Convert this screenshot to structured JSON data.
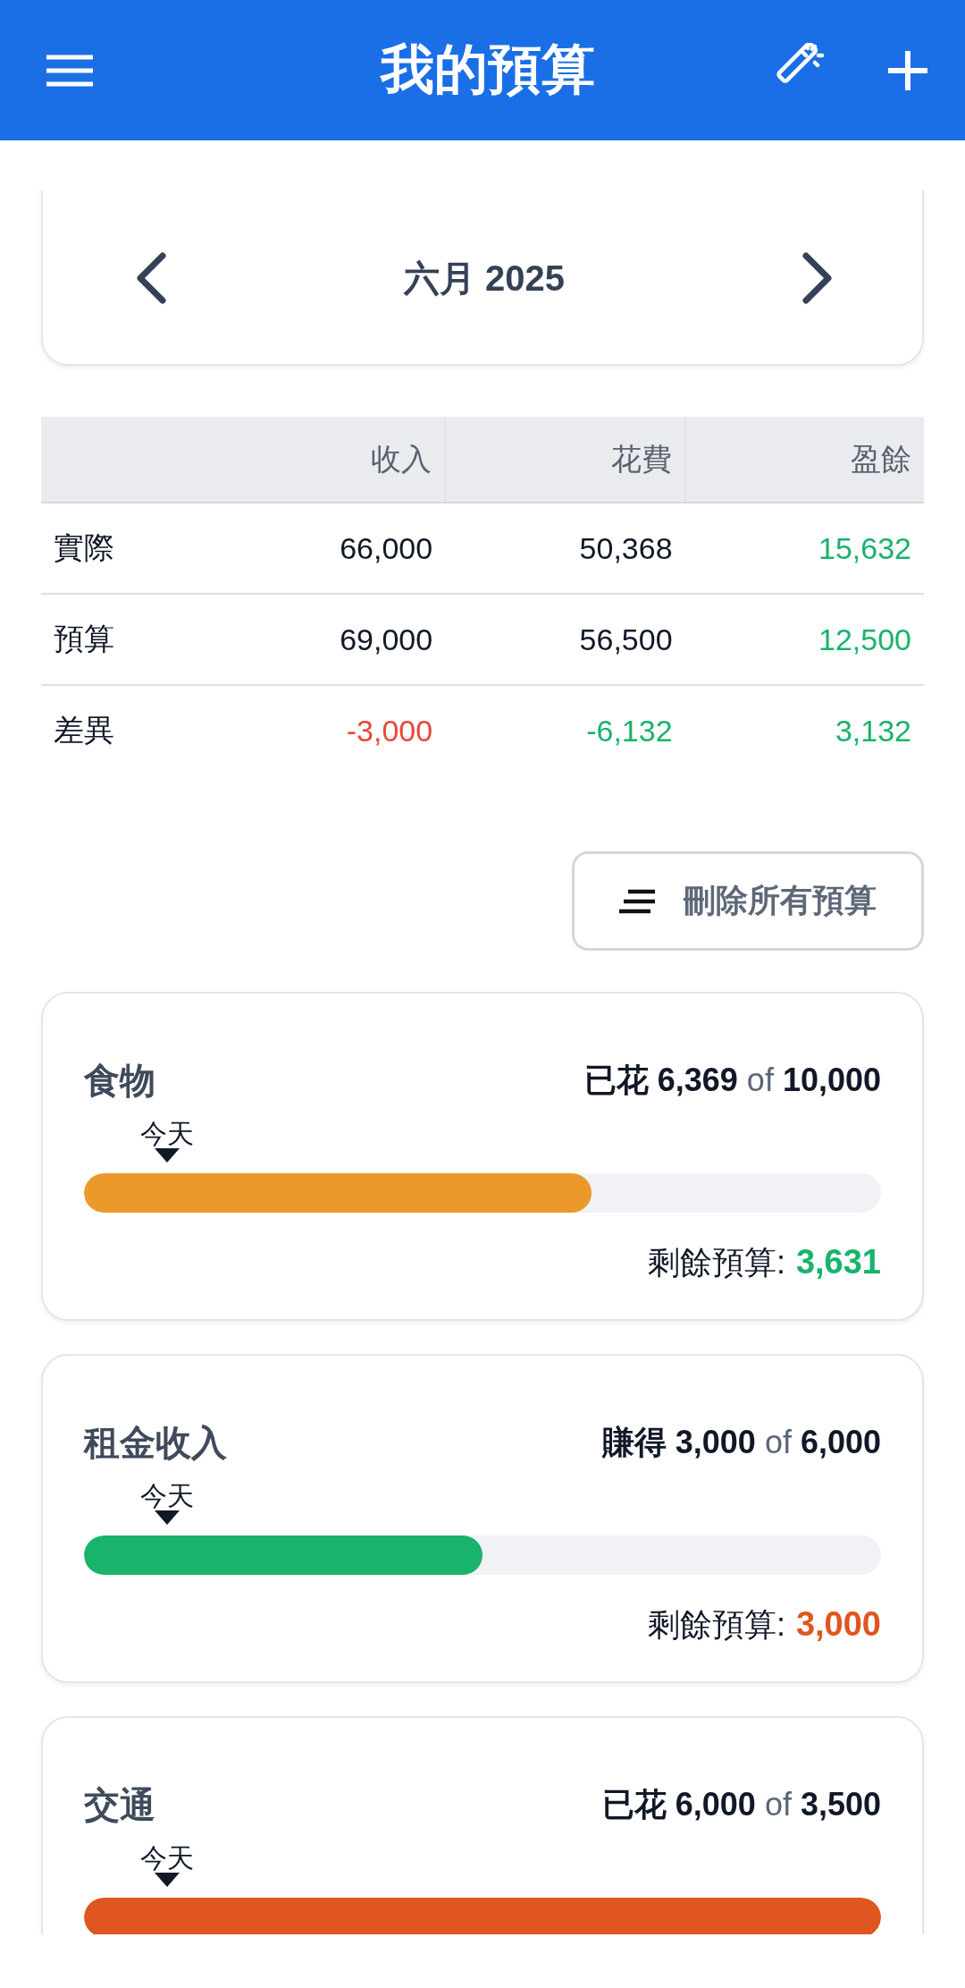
{
  "app_bar": {
    "title": "我的預算"
  },
  "month_nav": {
    "label": "六月 2025"
  },
  "summary_table": {
    "columns": [
      "",
      "收入",
      "花費",
      "盈餘"
    ],
    "rows": [
      {
        "cells": [
          {
            "text": "實際",
            "color": "#111827"
          },
          {
            "text": "66,000",
            "color": "#111827"
          },
          {
            "text": "50,368",
            "color": "#111827"
          },
          {
            "text": "15,632",
            "color": "#19b36b"
          }
        ]
      },
      {
        "cells": [
          {
            "text": "預算",
            "color": "#111827"
          },
          {
            "text": "69,000",
            "color": "#111827"
          },
          {
            "text": "56,500",
            "color": "#111827"
          },
          {
            "text": "12,500",
            "color": "#19b36b"
          }
        ]
      },
      {
        "cells": [
          {
            "text": "差異",
            "color": "#111827"
          },
          {
            "text": "-3,000",
            "color": "#e8473a"
          },
          {
            "text": "-6,132",
            "color": "#19b36b"
          },
          {
            "text": "3,132",
            "color": "#19b36b"
          }
        ]
      }
    ]
  },
  "delete_all_button": {
    "label": "刪除所有預算"
  },
  "budgets": [
    {
      "name": "食物",
      "amount": "**已花 6,369** of **10,000**",
      "today_label": "今天",
      "level": 0.637,
      "color": "#eb992a",
      "remaining_label": "剩餘預算:",
      "remaining": "3,631",
      "remaining_positive": true
    },
    {
      "name": "租金收入",
      "amount": "**賺得 3,000** of **6,000**",
      "today_label": "今天",
      "level": 0.5,
      "color": "#19b36b",
      "remaining_label": "剩餘預算:",
      "remaining": "3,000",
      "remaining_positive": false
    },
    {
      "name": "交通",
      "amount": "**已花 6,000** of **3,500**",
      "today_label": "今天",
      "level": 1,
      "color": "#df5620"
    }
  ]
}
